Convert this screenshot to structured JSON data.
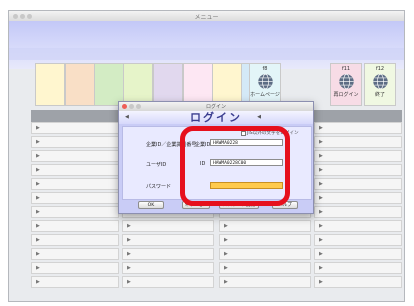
{
  "window": {
    "title": "メニュー"
  },
  "colors": {
    "key_colors": [
      "#fff6cf",
      "#f9dfc6",
      "#d3ecc4",
      "#e6f4c9",
      "#e1d8ee",
      "#fde7f3",
      "#fff6cf",
      "#d4e9f7"
    ],
    "fkey_bg": [
      "#e3f5f8",
      "#f7dce6",
      "#f0f8e2"
    ],
    "highlight": "#e6101d",
    "password_field": "#ffca4c"
  },
  "fkeys": [
    {
      "num": "f8",
      "label": "ホームページ",
      "icon": "globe-icon"
    },
    {
      "num": "f11",
      "label": "再ログイン",
      "icon": "globe-icon"
    },
    {
      "num": "f12",
      "label": "終了",
      "icon": "globe-icon"
    }
  ],
  "grid": {
    "arrow": "▶"
  },
  "login": {
    "window_title": "ログイン",
    "title": "ログイン",
    "title_left_arrow": "◀",
    "title_right_arrow": "◀",
    "checkbox_label": "JIS以外の文字をログイン",
    "company_label": "企業ID／企業識別番号",
    "company_label_suffix": "企業ID",
    "company_value": "HAWMA0228",
    "user_label": "ユーザID",
    "user_label_suffix": "ID",
    "user_value": "HAWMA0228C00",
    "password_label": "パスワード",
    "buttons": [
      "OK",
      "キャンセル",
      "パスワード変更",
      "ヘルプ"
    ]
  }
}
